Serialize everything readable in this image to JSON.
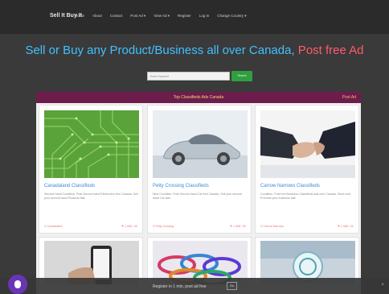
{
  "topbar": {
    "brand": "Sell It Buy It",
    "nav_items": [
      "Home",
      "About",
      "Contact",
      "Post Ad ▾",
      "View Ad ▾",
      "Register",
      "Log In",
      "Change Country ▾"
    ]
  },
  "hero": {
    "title_main": "Sell or Buy any Product/Business all over Canada,",
    "title_accent": " Post free Ad",
    "search_placeholder": "Enter Keyword",
    "search_button": "Search"
  },
  "panel": {
    "title": "Top Classifieds Ads Canada",
    "post_ad": "Post Ad"
  },
  "cards": [
    {
      "title": "Canadaland Classifieds",
      "desc": "Second Hand Condition. Post Second hand Electronics free Canada. Sell your second hand Products fast.",
      "category": "Canadaland",
      "views": "1,068 / 2K"
    },
    {
      "title": "Petty Crossing Classifieds",
      "desc": "New Condition. Post Second hand Car free Canada. Sell your second hand Car fast.",
      "category": "Petty Crossing",
      "views": "1,068 / 2K"
    },
    {
      "title": "Carrow Narrows Classifieds",
      "desc": "Condition. Post free Business Classifieds ads over Canada. Show and Promote your business fast.",
      "category": "Carrow Narrows",
      "views": "1,068 / 2K"
    }
  ],
  "bottom_bar": {
    "text": "Register in 1 min, post ad free",
    "go": "Go",
    "close": "×"
  },
  "colors": {
    "accent_blue": "#42c0ff",
    "accent_red": "#ff5b6b",
    "panel_header": "#6d1d4b",
    "search_green": "#2f9f3f"
  },
  "icons": {
    "chat": "chat-bubble-icon",
    "close": "close-icon",
    "location": "location-pin-icon",
    "views": "tag-icon"
  }
}
